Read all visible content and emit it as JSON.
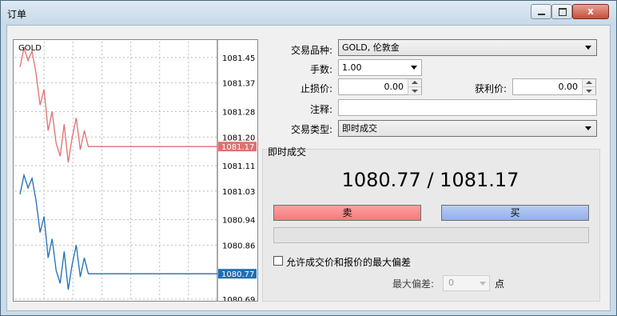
{
  "window": {
    "title": "订单",
    "close_label": "x"
  },
  "chart": {
    "symbol": "GOLD",
    "y_ticks": [
      "1081.45",
      "1081.37",
      "1081.28",
      "1081.20",
      "1081.11",
      "1081.03",
      "1080.94",
      "1080.86",
      "1080.69"
    ],
    "ask_label": "1081.17",
    "bid_label": "1080.77"
  },
  "chart_data": {
    "type": "line",
    "title": "GOLD",
    "ylim": [
      1080.69,
      1081.5
    ],
    "series": [
      {
        "values": [
          1081.42,
          1081.48,
          1081.44,
          1081.47,
          1081.4,
          1081.3,
          1081.35,
          1081.22,
          1081.28,
          1081.18,
          1081.14,
          1081.24,
          1081.12,
          1081.2,
          1081.26,
          1081.16,
          1081.22,
          1081.17,
          1081.17,
          1081.17,
          1081.17,
          1081.17,
          1081.17,
          1081.17,
          1081.17,
          1081.17,
          1081.17,
          1081.17,
          1081.17,
          1081.17
        ]
      },
      {
        "values": [
          1081.02,
          1081.08,
          1081.04,
          1081.07,
          1081.0,
          1080.9,
          1080.95,
          1080.82,
          1080.88,
          1080.78,
          1080.74,
          1080.84,
          1080.72,
          1080.8,
          1080.86,
          1080.76,
          1080.82,
          1080.77,
          1080.77,
          1080.77,
          1080.77,
          1080.77,
          1080.77,
          1080.77,
          1080.77,
          1080.77,
          1080.77,
          1080.77,
          1080.77,
          1080.77
        ]
      }
    ],
    "colors": [
      "#e07070",
      "#1f6fb5"
    ]
  },
  "form": {
    "symbol_label": "交易品种:",
    "symbol_value": "GOLD, 伦敦金",
    "volume_label": "手数:",
    "volume_value": "1.00",
    "sl_label": "止损价:",
    "sl_value": "0.00",
    "tp_label": "获利价:",
    "tp_value": "0.00",
    "comment_label": "注释:",
    "comment_value": "",
    "type_label": "交易类型:",
    "type_value": "即时成交"
  },
  "execution": {
    "section_label": "即时成交",
    "prices": "1080.77 / 1081.17",
    "sell_label": "卖",
    "buy_label": "买",
    "allow_deviation_label": "允许成交价和报价的最大偏差",
    "max_deviation_label": "最大偏差:",
    "max_deviation_value": "0",
    "unit_label": "点"
  }
}
